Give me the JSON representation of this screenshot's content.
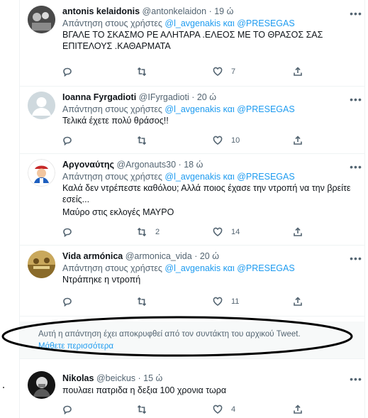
{
  "reply_prefix": "Απάντηση στους χρήστες",
  "reply_users": [
    "@l_avgenakis",
    "και",
    "@PRESEGAS"
  ],
  "tweets": [
    {
      "name": "antonis kelaidonis",
      "handle": "@antonkelaidon",
      "time": "19 ώ",
      "text": [
        "ΒΓΑΛΕ ΤΟ ΣΚΑΣΜΟ ΡΕ ΑΛΗΤΑΡΑ .ΕΛΕΟΣ ΜΕ ΤΟ ΘΡΑΣΟΣ ΣΑΣ ΕΠΙΤΕΛΟΥΣ .ΚΑΘΑΡΜΑΤΑ"
      ],
      "counts": {
        "reply": "",
        "retweet": "",
        "like": "7",
        "share": ""
      }
    },
    {
      "name": "Ioanna Fyrgadioti",
      "handle": "@IFyrgadioti",
      "time": "20 ώ",
      "text": [
        "Τελικά έχετε πολύ θράσος!!"
      ],
      "counts": {
        "reply": "",
        "retweet": "",
        "like": "10",
        "share": ""
      }
    },
    {
      "name": "Αργοναύτης",
      "handle": "@Argonauts30",
      "time": "18 ώ",
      "text": [
        "Καλά δεν ντρέπεστε καθόλου; Αλλά ποιος έχασε την ντροπή να την βρείτε εσείς...",
        "Μαύρο στις εκλογές ΜΑΥΡΟ"
      ],
      "counts": {
        "reply": "",
        "retweet": "2",
        "like": "14",
        "share": ""
      }
    },
    {
      "name": "Vida armónica",
      "handle": "@armonica_vida",
      "time": "20 ώ",
      "text": [
        "Ντράπηκε η ντροπή"
      ],
      "counts": {
        "reply": "",
        "retweet": "",
        "like": "11",
        "share": ""
      }
    },
    {
      "name": "Nikolas",
      "handle": "@beickus",
      "time": "15 ώ",
      "text": [
        "πουλαει πατριδα η δεξια 100 χρονια τωρα"
      ],
      "counts": {
        "reply": "",
        "retweet": "",
        "like": "4",
        "share": ""
      }
    }
  ],
  "hidden_reply": {
    "message": "Αυτή η απάντηση έχει αποκρυφθεί από τον συντάκτη του αρχικού Tweet.",
    "learn_more": "Μάθετε περισσότερα"
  },
  "icons": {
    "reply": "reply-icon",
    "retweet": "retweet-icon",
    "like": "heart-icon",
    "share": "share-icon",
    "more": "more-icon"
  },
  "colors": {
    "link": "#1d9bf0",
    "secondary": "#536471",
    "annotation": "#000000",
    "hidden_bg": "#f7f9f9"
  }
}
